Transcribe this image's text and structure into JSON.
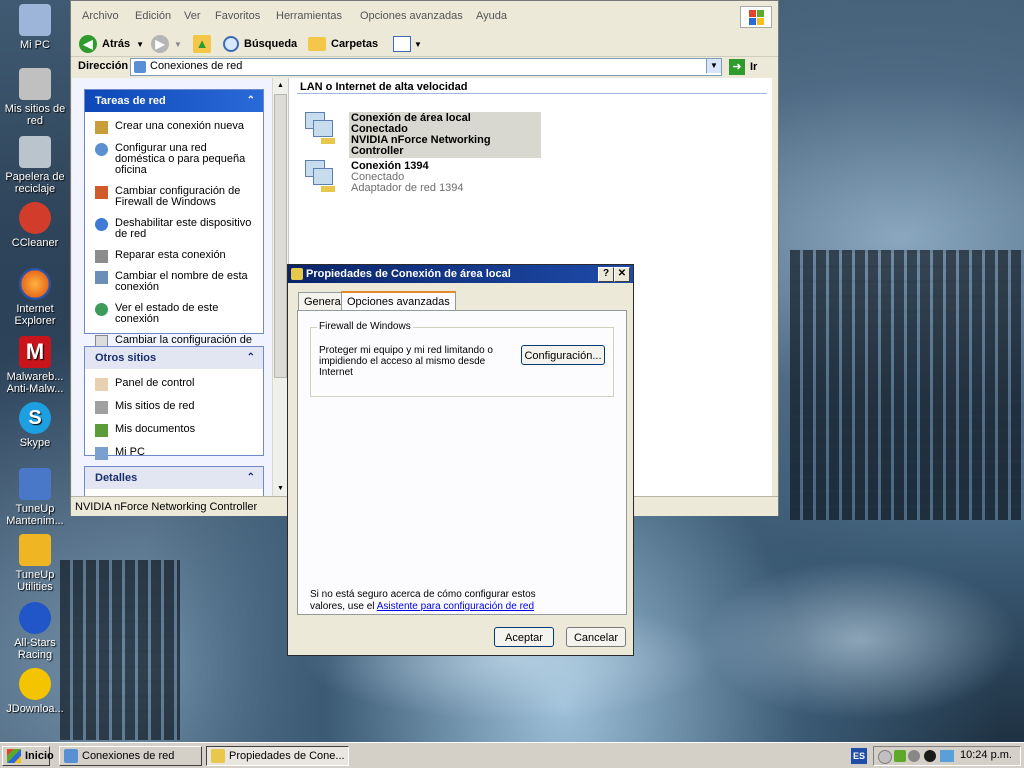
{
  "desktop": {
    "icons": [
      {
        "label": "Mi PC",
        "icon": "my-computer-icon",
        "color": "#9db5d8"
      },
      {
        "label": "Mis sitios de red",
        "icon": "network-places-icon",
        "color": "#c0c0c0"
      },
      {
        "label": "Papelera de reciclaje",
        "icon": "recycle-bin-icon",
        "color": "#b9c4cc"
      },
      {
        "label": "CCleaner",
        "icon": "ccleaner-icon",
        "color": "#d13d2a"
      },
      {
        "label": "Internet Explorer",
        "icon": "firefox-icon",
        "color": "#e66b1d"
      },
      {
        "label": "Malwareb... Anti-Malw...",
        "icon": "malwarebytes-icon",
        "color": "#c8141a"
      },
      {
        "label": "Skype",
        "icon": "skype-icon",
        "color": "#1e9fe0"
      },
      {
        "label": "TuneUp Mantenim...",
        "icon": "tuneup-maintenance-icon",
        "color": "#4a78c8"
      },
      {
        "label": "TuneUp Utilities",
        "icon": "tuneup-utilities-icon",
        "color": "#f0b522"
      },
      {
        "label": "All-Stars Racing",
        "icon": "sonic-racing-icon",
        "color": "#2056c8"
      },
      {
        "label": "JDownloa...",
        "icon": "jdownloader-icon",
        "color": "#f4c400"
      }
    ]
  },
  "explorer": {
    "menu": [
      "Archivo",
      "Edición",
      "Ver",
      "Favoritos",
      "Herramientas",
      "Opciones avanzadas",
      "Ayuda"
    ],
    "toolbar": {
      "back": "Atrás",
      "search": "Búsqueda",
      "folders": "Carpetas"
    },
    "address": {
      "label": "Dirección",
      "value": "Conexiones de red",
      "go": "Ir"
    },
    "tasks_title": "Tareas de red",
    "tasks": [
      "Crear una conexión nueva",
      "Configurar una red doméstica o para pequeña oficina",
      "Cambiar configuración de Firewall de Windows",
      "Deshabilitar este dispositivo de red",
      "Reparar esta conexión",
      "Cambiar el nombre de esta conexión",
      "Ver el estado de este conexión",
      "Cambiar la configuración de esta conexión"
    ],
    "other_title": "Otros sitios",
    "other": [
      "Panel de control",
      "Mis sitios de red",
      "Mis documentos",
      "Mi PC"
    ],
    "details_title": "Detalles",
    "section_title": "LAN o Internet de alta velocidad",
    "connections": [
      {
        "name": "Conexión de área local",
        "status": "Conectado",
        "device": "NVIDIA nForce Networking Controller",
        "selected": true
      },
      {
        "name": "Conexión 1394",
        "status": "Conectado",
        "device": "Adaptador de red 1394",
        "selected": false
      }
    ],
    "status": "NVIDIA nForce Networking Controller"
  },
  "dialog": {
    "title": "Propiedades de Conexión de área local",
    "help": "?",
    "close": "✕",
    "tabs": [
      "General",
      "Opciones avanzadas"
    ],
    "active_tab": "Opciones avanzadas",
    "group_title": "Firewall de Windows",
    "group_text": "Proteger mi equipo y mi red limitando o impidiendo el acceso al mismo desde Internet",
    "config_button": "Configuración...",
    "footer_text": "Si no está seguro acerca de cómo configurar estos valores, use el",
    "footer_link": "Asistente para configuración de red",
    "ok": "Aceptar",
    "cancel": "Cancelar"
  },
  "taskbar": {
    "start": "Inicio",
    "buttons": [
      {
        "label": "Conexiones de red",
        "pressed": false
      },
      {
        "label": "Propiedades de Cone...",
        "pressed": true
      }
    ],
    "language": "ES",
    "clock": "10:24 p.m."
  },
  "colors": {
    "title_bar": "#0a246a",
    "task_header": "#0d47b8",
    "link": "#0000ee"
  }
}
